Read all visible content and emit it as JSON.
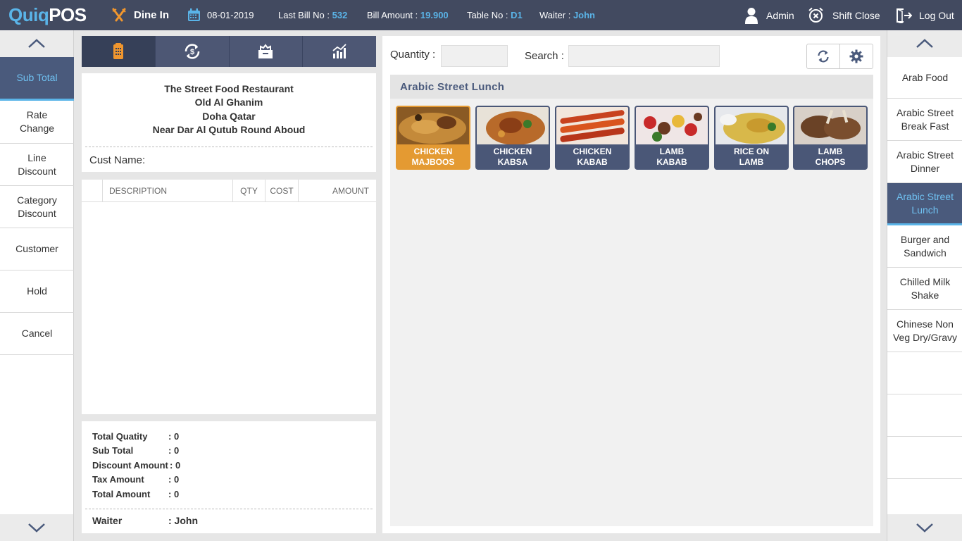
{
  "app": {
    "logo_part1": "Quiq",
    "logo_part2": "POS"
  },
  "header": {
    "mode": "Dine In",
    "date": "08-01-2019",
    "last_bill_label": "Last Bill No :",
    "last_bill_value": "532",
    "bill_amount_label": "Bill Amount :",
    "bill_amount_value": "19.900",
    "table_label": "Table No :",
    "table_value": "D1",
    "waiter_label": "Waiter :",
    "waiter_value": "John",
    "user": "Admin",
    "shift_close": "Shift Close",
    "logout": "Log Out",
    "colors": {
      "bar": "#424a60",
      "accent": "#5ab4e8",
      "orange": "#f0962e"
    }
  },
  "left_menu": [
    {
      "label": "Sub Total",
      "active": true
    },
    {
      "label": "Rate Change"
    },
    {
      "label": "Line Discount"
    },
    {
      "label": "Category Discount"
    },
    {
      "label": "Customer"
    },
    {
      "label": "Hold"
    },
    {
      "label": "Cancel"
    }
  ],
  "tabs": [
    {
      "icon": "bill-icon",
      "active": true
    },
    {
      "icon": "dollar-refresh-icon"
    },
    {
      "icon": "cash-drawer-icon"
    },
    {
      "icon": "bar-chart-icon"
    }
  ],
  "receipt": {
    "line1": "The Street Food Restaurant",
    "line2": "Old Al Ghanim",
    "line3": "Doha Qatar",
    "line4": "Near Dar Al Qutub Round Aboud",
    "cust_label": "Cust Name:"
  },
  "table": {
    "headers": [
      "DESCRIPTION",
      "QTY",
      "COST",
      "AMOUNT"
    ],
    "rows": []
  },
  "totals": {
    "total_quantity_label": "Total Quatity",
    "total_quantity": ": 0",
    "sub_total_label": "Sub Total",
    "sub_total": ": 0",
    "discount_label": "Discount Amount",
    "discount": ": 0",
    "tax_label": "Tax Amount",
    "tax": ": 0",
    "total_amount_label": "Total Amount",
    "total_amount": ": 0",
    "waiter_label": "Waiter",
    "waiter": ": John"
  },
  "main": {
    "quantity_label": "Quantity :",
    "quantity_value": "",
    "search_label": "Search :",
    "search_value": "",
    "category_title": "Arabic Street Lunch",
    "items": [
      {
        "line1": "CHICKEN",
        "line2": "MAJBOOS",
        "selected": true
      },
      {
        "line1": "CHICKEN",
        "line2": "KABSA"
      },
      {
        "line1": "CHICKEN",
        "line2": "KABAB"
      },
      {
        "line1": "LAMB",
        "line2": "KABAB"
      },
      {
        "line1": "RICE ON",
        "line2": "LAMB"
      },
      {
        "line1": "LAMB",
        "line2": "CHOPS"
      }
    ]
  },
  "categories": [
    {
      "label": "Arab Food"
    },
    {
      "label": "Arabic Street Break Fast"
    },
    {
      "label": "Arabic Street Dinner"
    },
    {
      "label": "Arabic Street Lunch",
      "active": true
    },
    {
      "label": "Burger and Sandwich"
    },
    {
      "label": "Chilled Milk Shake"
    },
    {
      "label": "Chinese Non Veg Dry/Gravy"
    },
    {
      "label": ""
    },
    {
      "label": ""
    },
    {
      "label": ""
    }
  ]
}
